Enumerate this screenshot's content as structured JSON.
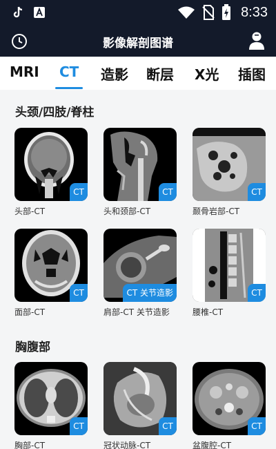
{
  "status_bar": {
    "time": "8:33"
  },
  "app_bar": {
    "title": "影像解剖图谱"
  },
  "tabs": [
    {
      "label": "MRI"
    },
    {
      "label": "CT"
    },
    {
      "label": "造影"
    },
    {
      "label": "断层"
    },
    {
      "label": "X光"
    },
    {
      "label": "插图"
    }
  ],
  "active_tab": "CT",
  "sections": [
    {
      "title": "头颈/四肢/脊柱",
      "items": [
        {
          "label": "头部-CT",
          "badge": "CT"
        },
        {
          "label": "头和颈部-CT",
          "badge": "CT"
        },
        {
          "label": "颞骨岩部-CT",
          "badge": "CT"
        },
        {
          "label": "面部-CT",
          "badge": "CT"
        },
        {
          "label": "肩部-CT 关节造影",
          "badge": "CT 关节造影"
        },
        {
          "label": "腰椎-CT",
          "badge": "CT"
        }
      ]
    },
    {
      "title": "胸腹部",
      "items": [
        {
          "label": "胸部-CT",
          "badge": "CT"
        },
        {
          "label": "冠状动脉-CT",
          "badge": "CT"
        },
        {
          "label": "盆腹腔-CT",
          "badge": "CT"
        }
      ]
    }
  ],
  "colors": {
    "accent": "#1e8ce0",
    "bar": "#131a2a"
  }
}
